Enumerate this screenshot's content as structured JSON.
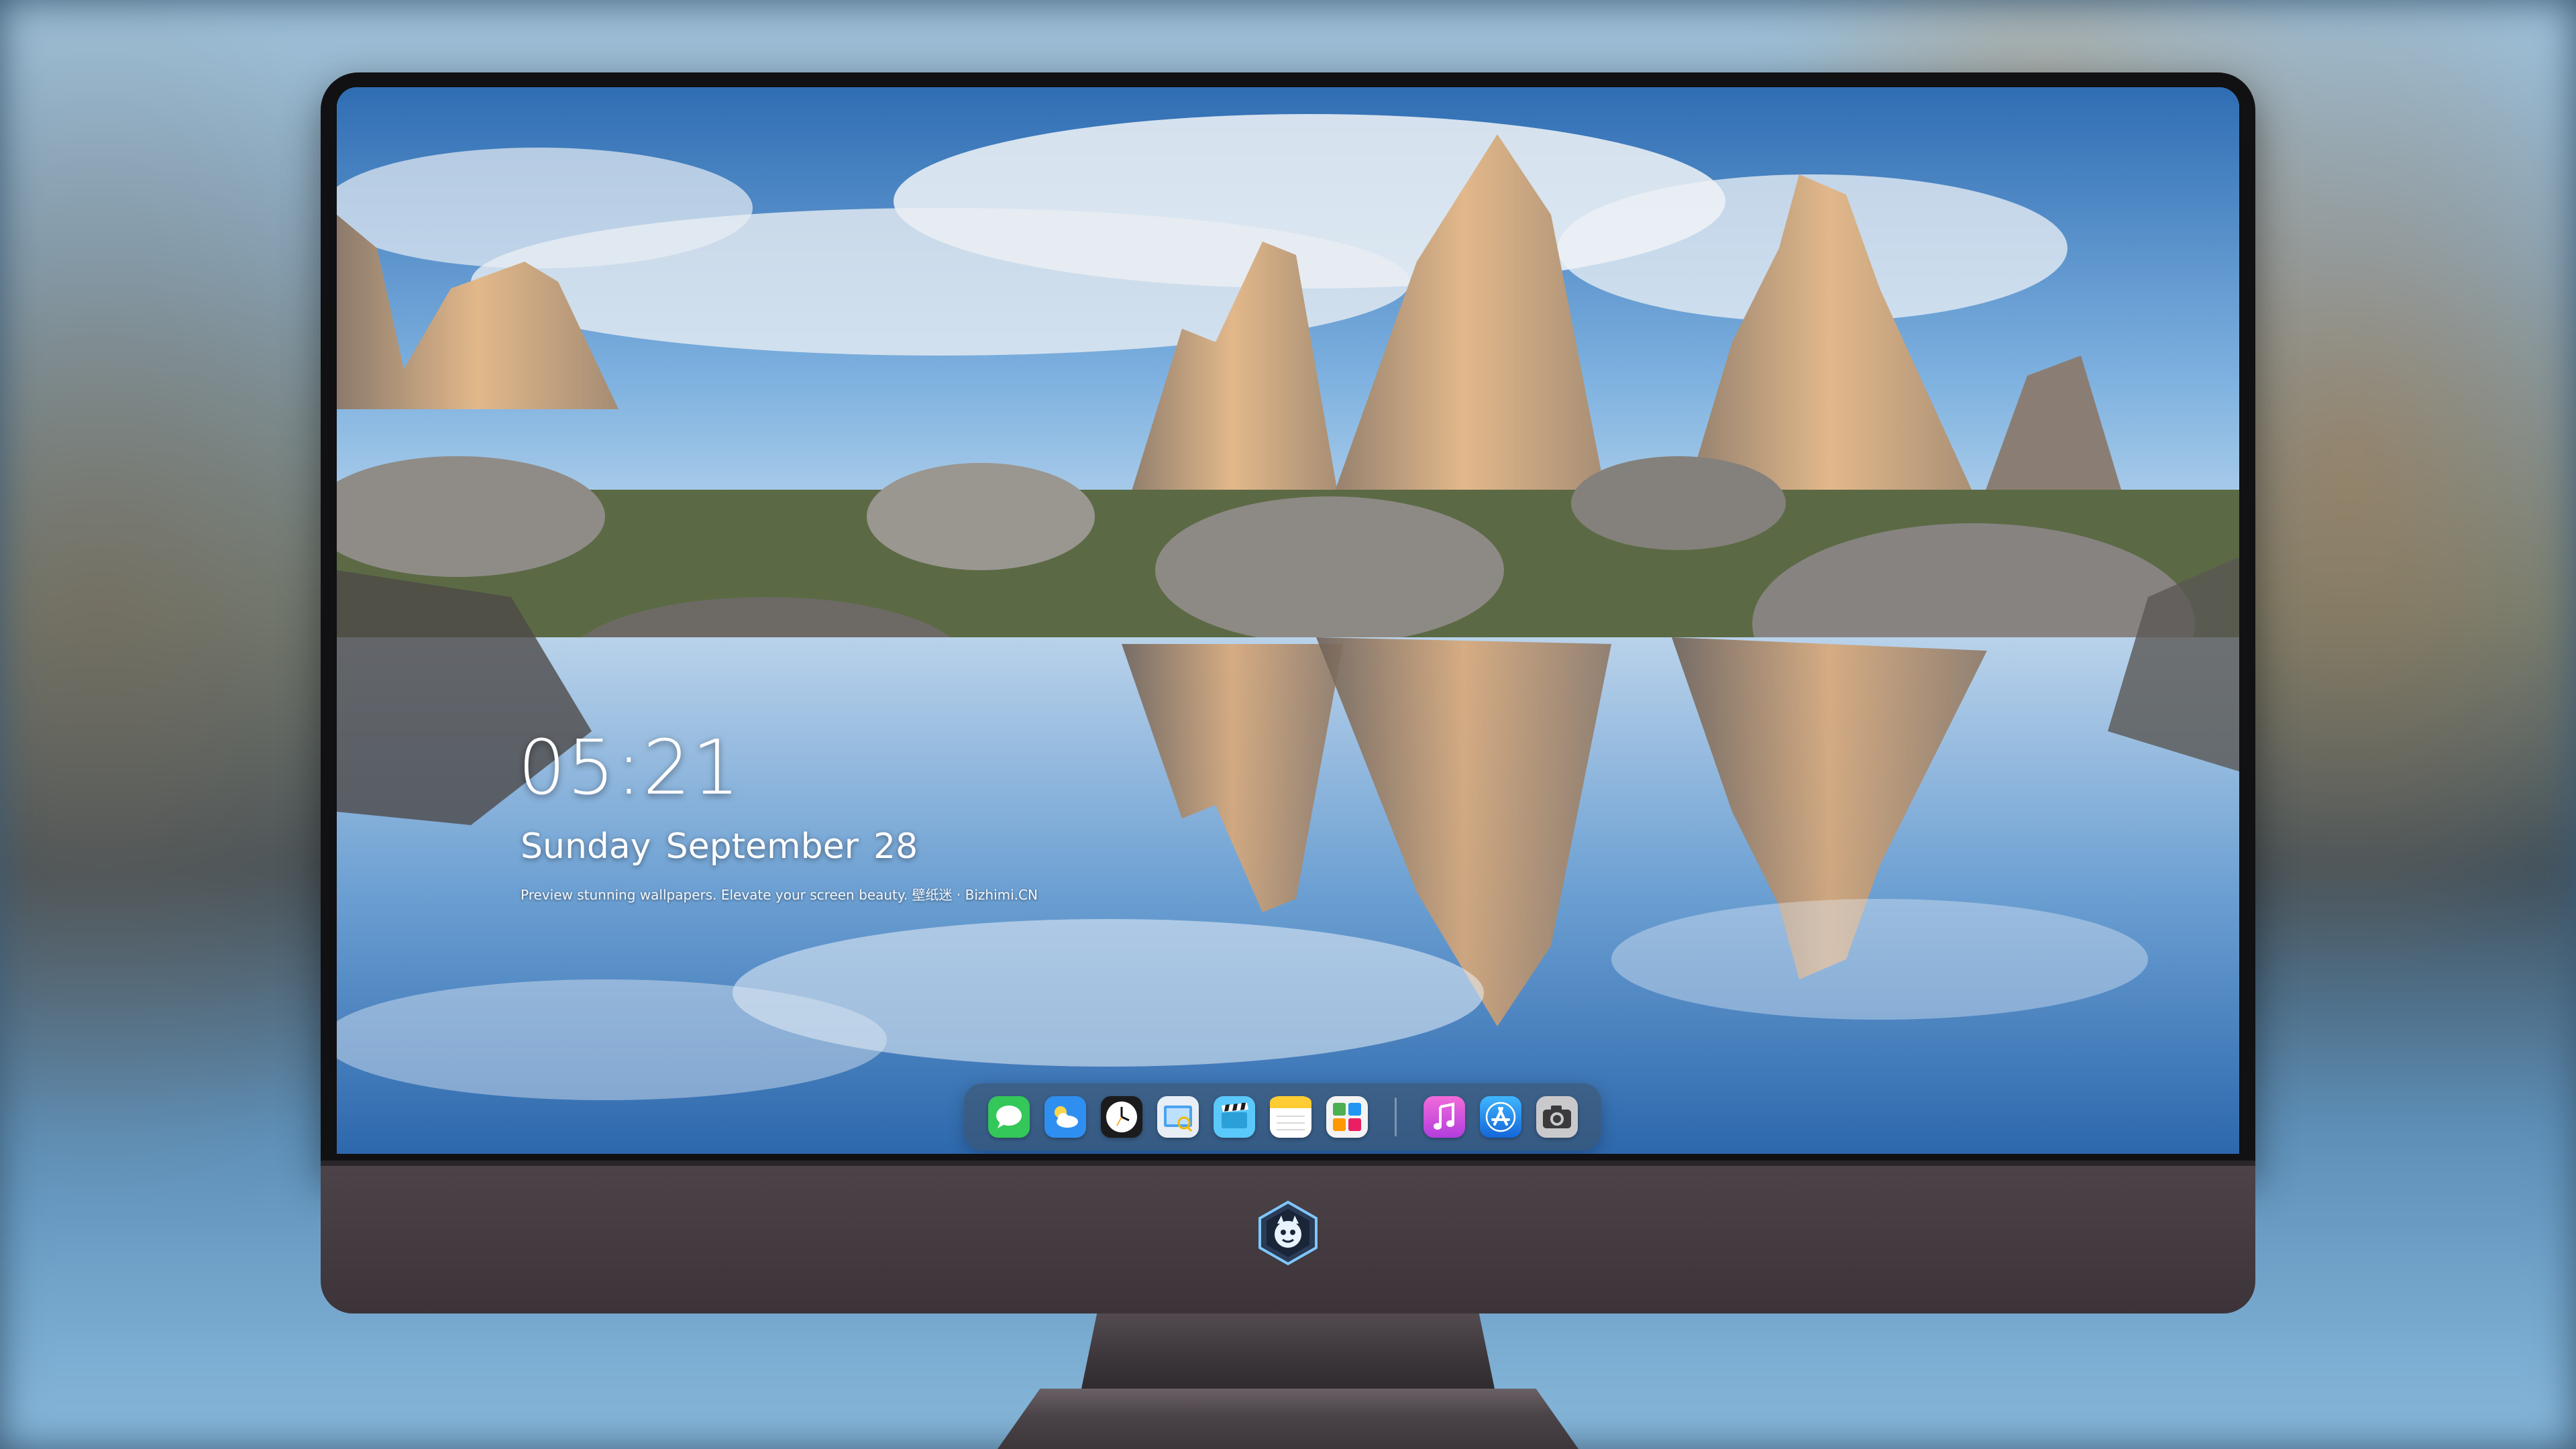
{
  "lockscreen": {
    "time": "05:21",
    "weekday": "Sunday",
    "month": "September",
    "day": "28",
    "tagline": "Preview stunning wallpapers. Elevate your screen beauty. 壁纸迷 · Bizhimi.CN"
  },
  "dock": {
    "apps": [
      {
        "name": "Messages",
        "icon": "messages-icon"
      },
      {
        "name": "Weather",
        "icon": "weather-icon"
      },
      {
        "name": "Clock",
        "icon": "clock-icon"
      },
      {
        "name": "Preview",
        "icon": "preview-icon"
      },
      {
        "name": "Clips",
        "icon": "clapper-icon"
      },
      {
        "name": "Notes",
        "icon": "notes-icon"
      },
      {
        "name": "Photo Gallery",
        "icon": "gallery-icon"
      },
      {
        "name": "Music",
        "icon": "music-icon"
      },
      {
        "name": "App Store",
        "icon": "app-store-icon"
      },
      {
        "name": "Camera",
        "icon": "camera-icon"
      }
    ]
  },
  "monitor": {
    "chin_logo": "dragon-mascot-logo"
  },
  "colors": {
    "bezel": "#111013",
    "chin": "#463e43",
    "dock_bg": "#3c4e60",
    "messages": "#34c759",
    "weather": "#2f8ff0",
    "music": "#e94bd6",
    "app_store": "#1c8cf0"
  }
}
